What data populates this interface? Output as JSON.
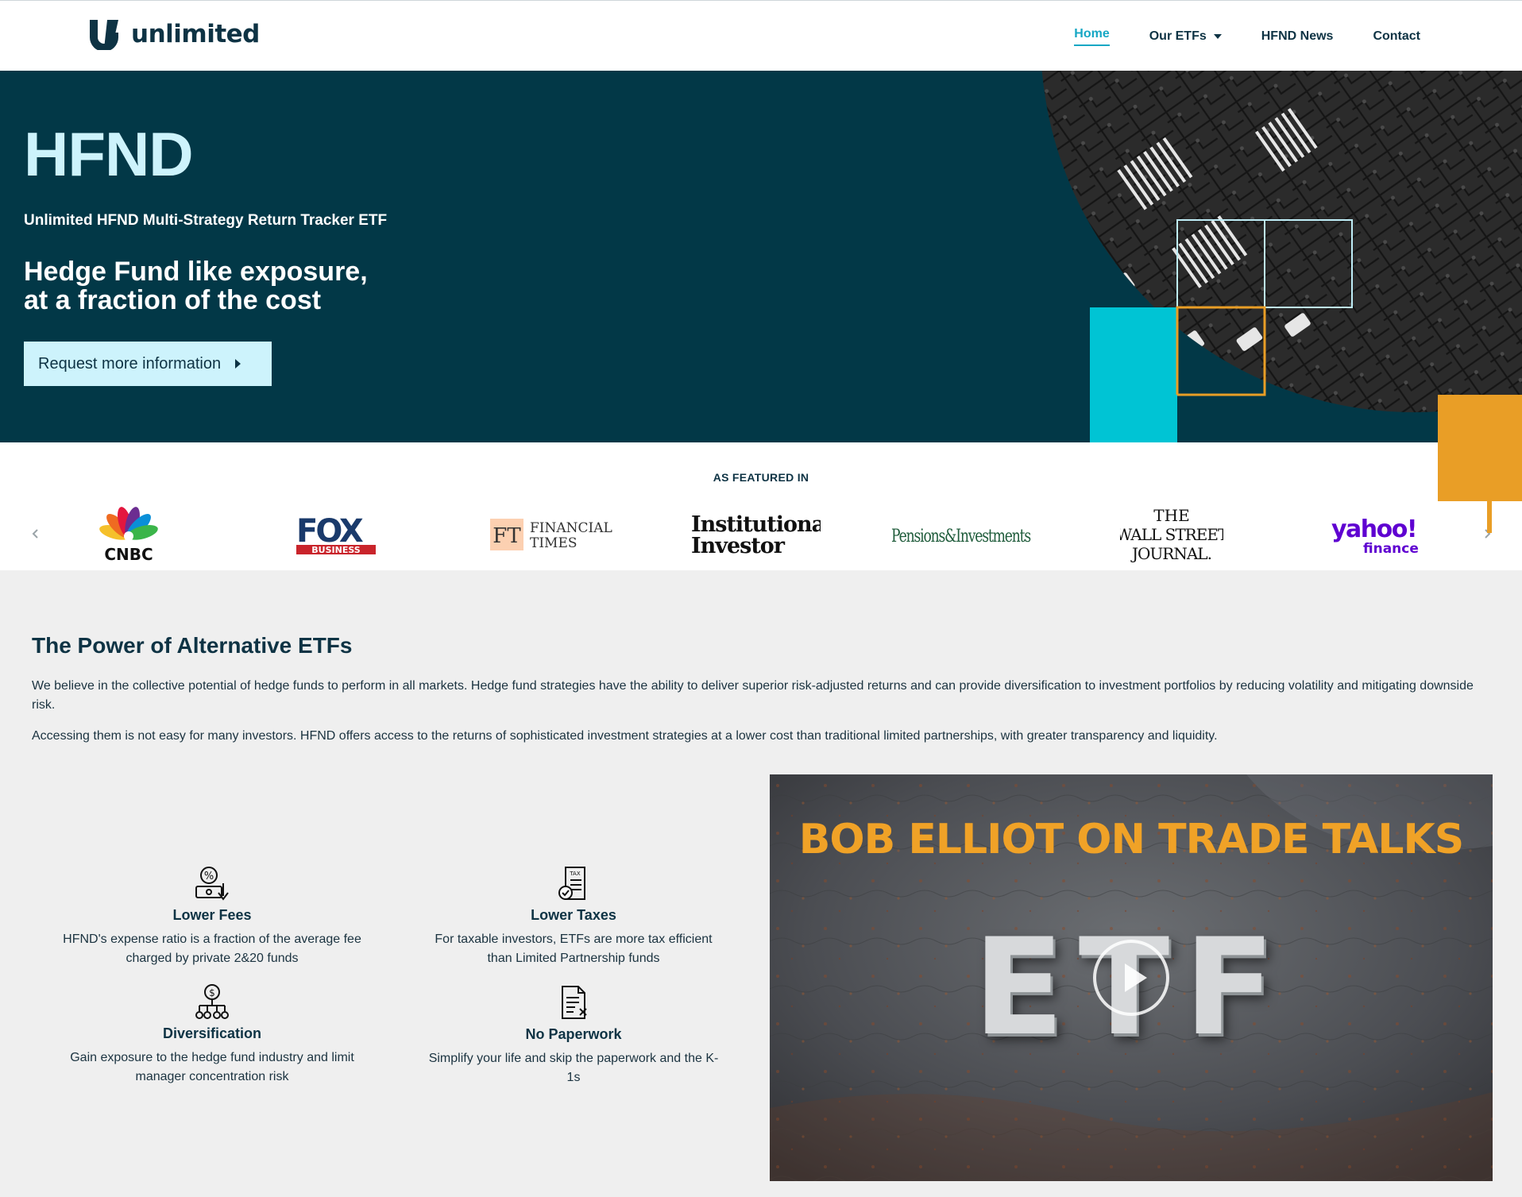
{
  "nav": {
    "brand": "unlimited",
    "links": [
      {
        "label": "Home",
        "active": true
      },
      {
        "label": "Our ETFs",
        "dropdown": true
      },
      {
        "label": "HFND News"
      },
      {
        "label": "Contact"
      }
    ]
  },
  "hero": {
    "title": "HFND",
    "subtitle": "Unlimited HFND Multi-Strategy Return Tracker ETF",
    "tagline_line1": "Hedge Fund like exposure,",
    "tagline_line2": "at a fraction of the cost",
    "cta_label": "Request more information"
  },
  "featured": {
    "label": "AS FEATURED IN",
    "logos": [
      "CNBC",
      "FOX BUSINESS",
      "FINANCIAL TIMES",
      "Institutional Investor",
      "Pensions&Investments",
      "THE WALL STREET JOURNAL.",
      "yahoo! finance"
    ],
    "logo_text": {
      "cnbc": "CNBC",
      "fox": "FOX",
      "fox_sub": "BUSINESS",
      "ft_mark": "FT",
      "ft_line1": "FINANCIAL",
      "ft_line2": "TIMES",
      "ii_line1": "Institutional",
      "ii_line2": "Investor",
      "pi": "Pensions&Investments",
      "wsj_line1": "THE",
      "wsj_line2": "WALL STREET",
      "wsj_line3": "JOURNAL.",
      "yahoo": "yahoo!",
      "yahoo_sub": "finance"
    }
  },
  "power": {
    "title": "The Power of Alternative ETFs",
    "paragraph1": "We believe in the collective potential of hedge funds to perform in all markets. Hedge fund strategies have the ability to deliver superior risk-adjusted returns and can provide diversification to investment portfolios by reducing volatility and mitigating downside risk.",
    "paragraph2": "Accessing them is not easy for many investors. HFND offers access to the returns of sophisticated investment strategies at a lower cost than traditional limited partnerships, with greater transparency and liquidity.",
    "features": [
      {
        "title": "Lower Fees",
        "desc": "HFND's expense ratio is a fraction of the average fee charged by private 2&20 funds",
        "icon": "percent-fees-icon"
      },
      {
        "title": "Lower Taxes",
        "desc": "For taxable investors, ETFs are more tax efficient than Limited Partnership funds",
        "icon": "tax-document-icon"
      },
      {
        "title": "Diversification",
        "desc": "Gain exposure to the hedge fund industry and limit manager concentration risk",
        "icon": "diversification-icon"
      },
      {
        "title": "No Paperwork",
        "desc": "Simplify your life and skip the paperwork and the K-1s",
        "icon": "no-paperwork-icon"
      }
    ]
  },
  "video": {
    "title": "BOB ELLIOT ON TRADE TALKS",
    "overlay_text": "ETF"
  },
  "colors": {
    "navy": "#023847",
    "ink": "#0e3344",
    "light_cyan": "#cdf3fc",
    "teal": "#16a7c4",
    "cyan_square": "#00c4d4",
    "orange": "#e99e26",
    "gray_bg": "#efefef"
  }
}
